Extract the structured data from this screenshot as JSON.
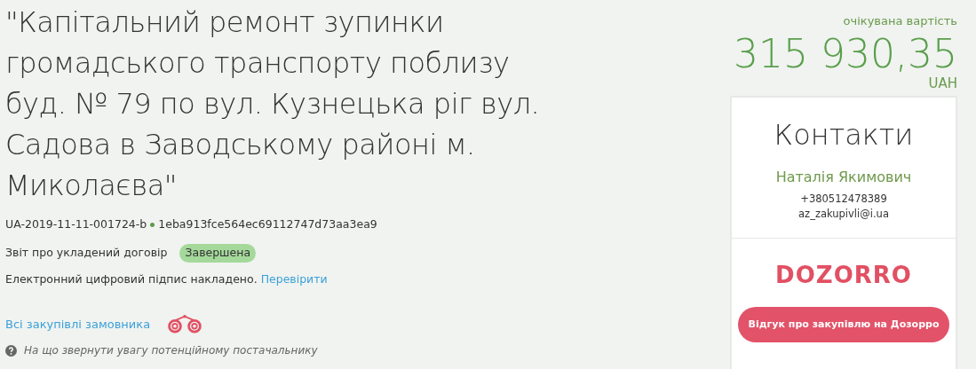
{
  "title": "\"Капітальний ремонт зупинки громадського транспорту поблизу буд. № 79 по вул. Кузнецька ріг вул. Садова в Заводському районі м. Миколаєва\"",
  "ids": {
    "tender_id": "UA-2019-11-11-001724-b",
    "hash": "1eba913fce564ec69112747d73aa3ea9"
  },
  "report": {
    "label": "Звіт про укладений договір",
    "status": "Завершена"
  },
  "signature": {
    "text": "Електронний цифровий підпис накладено.",
    "link": "Перевірити"
  },
  "customer_link": "Всі закупівлі замовника",
  "hint": "На що звернути увагу потенційному постачальнику",
  "value": {
    "label": "очікувана вартість",
    "amount": "315 930,35",
    "currency": "UAH"
  },
  "contacts": {
    "title": "Контакти",
    "name": "Наталія Якимович",
    "phone": "+380512478389",
    "email": "az_zakupivli@i.ua"
  },
  "dozorro": {
    "logo": "DOZORRO",
    "button": "Відгук про закупівлю на Дозорро"
  }
}
